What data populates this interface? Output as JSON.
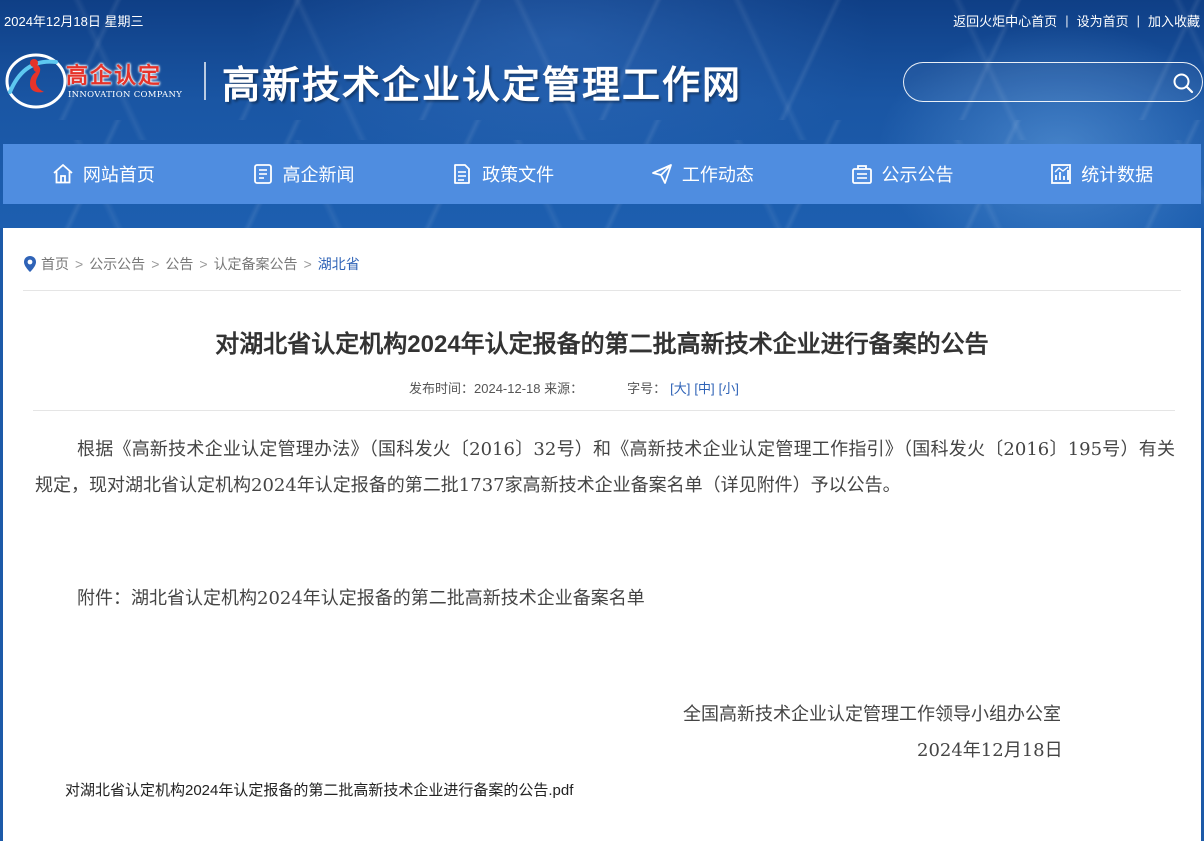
{
  "topbar": {
    "date": "2024年12月18日 星期三",
    "links": [
      "返回火炬中心首页",
      "设为首页",
      "加入收藏"
    ]
  },
  "logo": {
    "cn": "高企认定",
    "en": "INNOVATION COMPANY"
  },
  "site_title": "高新技术企业认定管理工作网",
  "search": {
    "placeholder": ""
  },
  "nav": [
    {
      "label": "网站首页",
      "icon": "home-icon"
    },
    {
      "label": "高企新闻",
      "icon": "news-icon"
    },
    {
      "label": "政策文件",
      "icon": "document-icon"
    },
    {
      "label": "工作动态",
      "icon": "paper-plane-icon"
    },
    {
      "label": "公示公告",
      "icon": "announcement-icon"
    },
    {
      "label": "统计数据",
      "icon": "chart-icon"
    }
  ],
  "breadcrumb": {
    "items": [
      "首页",
      "公示公告",
      "公告",
      "认定备案公告"
    ],
    "current": "湖北省"
  },
  "article": {
    "title": "对湖北省认定机构2024年认定报备的第二批高新技术企业进行备案的公告",
    "meta_date": "发布时间：2024-12-18 来源：",
    "font_size_label": "字号：",
    "font_sizes": [
      "[大]",
      "[中]",
      "[小]"
    ],
    "body": "根据《高新技术企业认定管理办法》（国科发火〔2016〕32号）和《高新技术企业认定管理工作指引》（国科发火〔2016〕195号）有关规定，现对湖北省认定机构2024年认定报备的第二批1737家高新技术企业备案名单（详见附件）予以公告。",
    "attachment": "附件：湖北省认定机构2024年认定报备的第二批高新技术企业备案名单",
    "sign_org": "全国高新技术企业认定管理工作领导小组办公室",
    "sign_date": "2024年12月18日",
    "pdf": "对湖北省认定机构2024年认定报备的第二批高新技术企业进行备案的公告.pdf"
  },
  "colors": {
    "header_blue": "#1a56a4",
    "nav_blue": "#4f8de0",
    "logo_red": "#e6332a",
    "link_blue": "#2f63b7"
  }
}
